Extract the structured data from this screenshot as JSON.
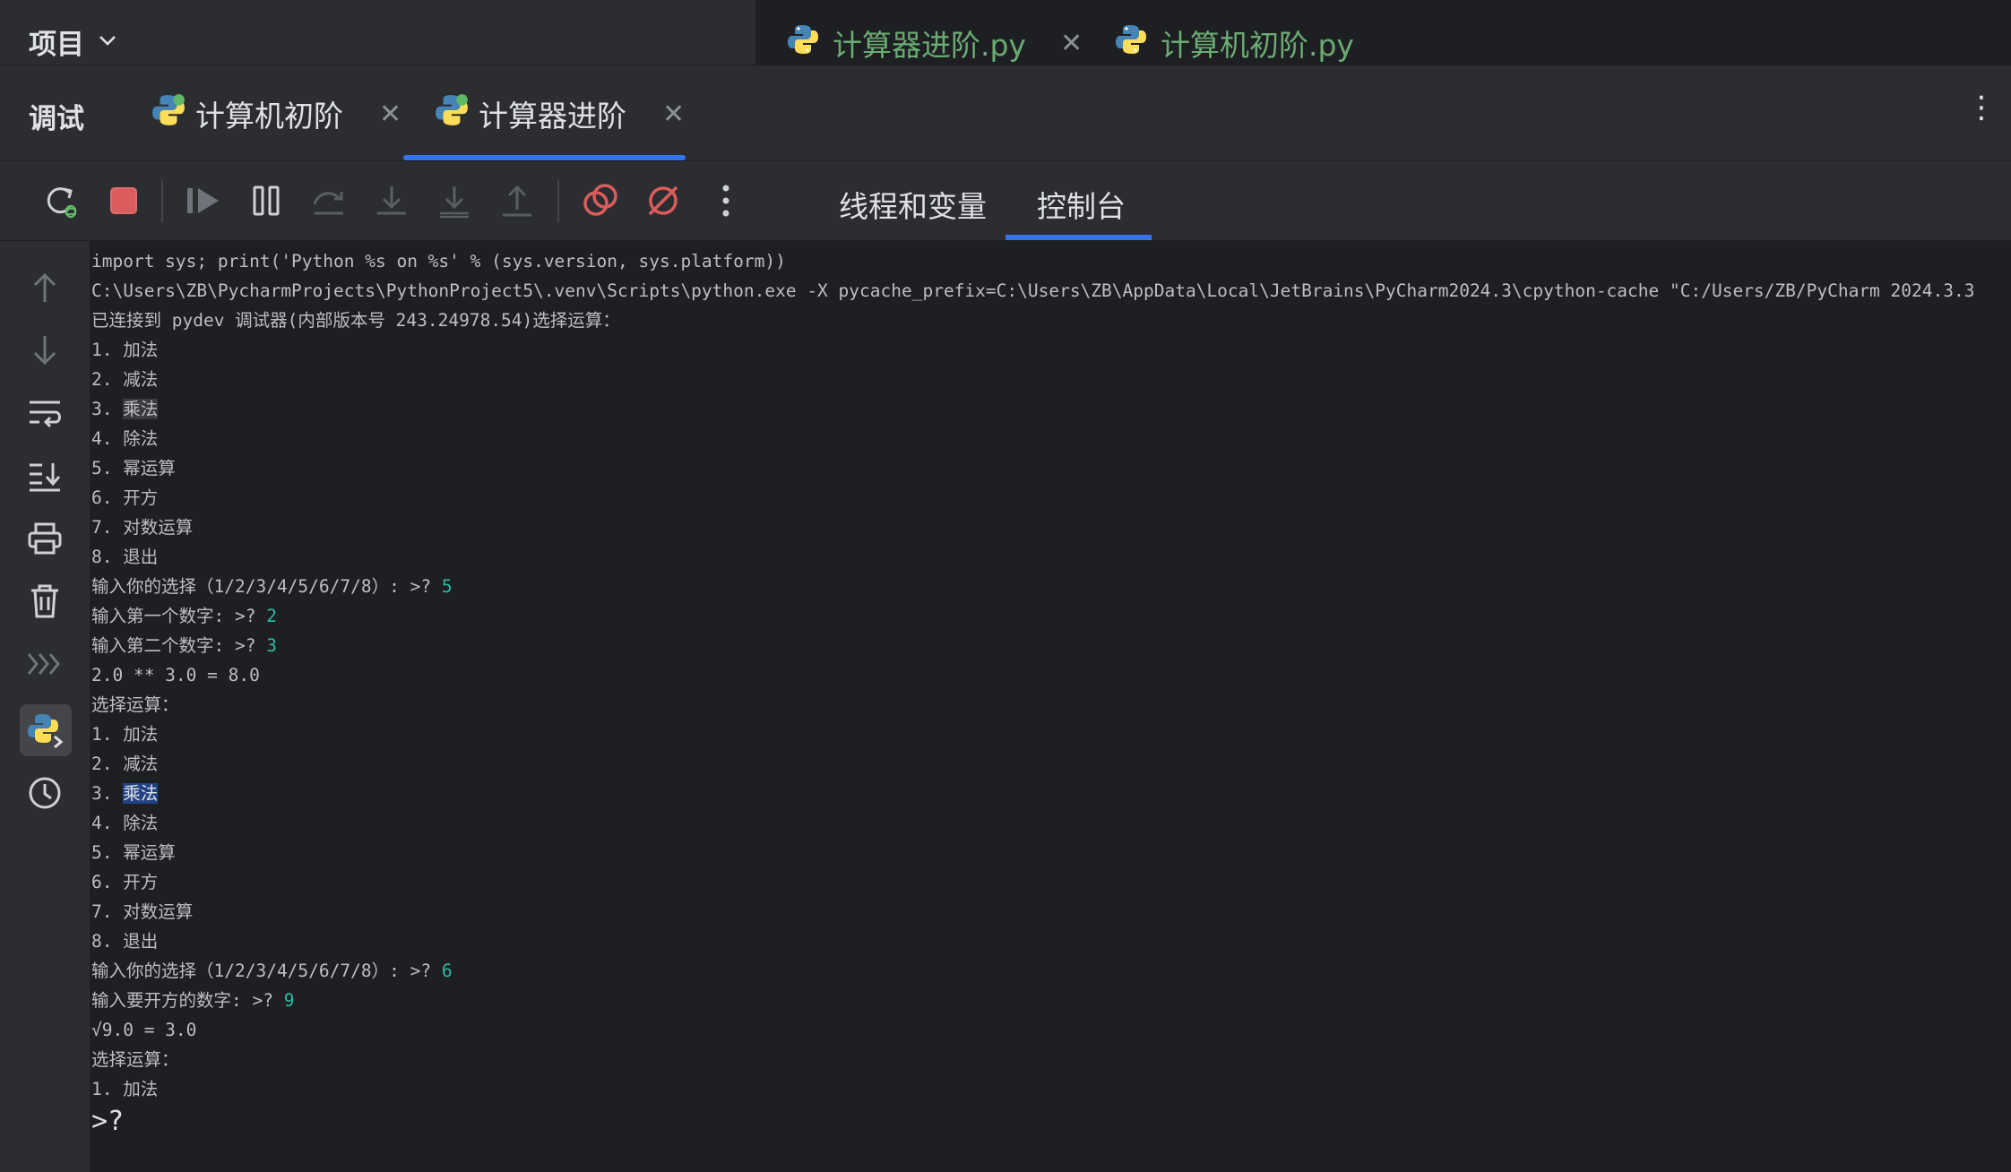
{
  "project": {
    "label": "项目"
  },
  "editor_tabs": [
    {
      "label": "计算器进阶.py"
    },
    {
      "label": "计算机初阶.py"
    }
  ],
  "debug": {
    "title": "调试",
    "tabs": [
      {
        "label": "计算机初阶"
      },
      {
        "label": "计算器进阶"
      }
    ],
    "view_tabs": [
      {
        "label": "线程和变量"
      },
      {
        "label": "控制台"
      }
    ]
  },
  "colors": {
    "accent": "#3574f0",
    "user_input": "#2fbaa3",
    "run_green": "#5fb865",
    "stop_red": "#db5c5c"
  },
  "console": {
    "lines": [
      {
        "text": "import sys; print('Python %s on %s' % (sys.version, sys.platform))"
      },
      {
        "text": "C:\\Users\\ZB\\PycharmProjects\\PythonProject5\\.venv\\Scripts\\python.exe -X pycache_prefix=C:\\Users\\ZB\\AppData\\Local\\JetBrains\\PyCharm2024.3\\cpython-cache \"C:/Users/ZB/PyCharm 2024.3.3"
      },
      {
        "text": "已连接到 pydev 调试器(内部版本号 243.24978.54)选择运算："
      },
      {
        "text": "1. 加法"
      },
      {
        "text": "2. 减法"
      },
      {
        "text": "3. ",
        "mark": "乘法",
        "mark_style": "grey"
      },
      {
        "text": "4. 除法"
      },
      {
        "text": "5. 幂运算"
      },
      {
        "text": "6. 开方"
      },
      {
        "text": "7. 对数运算"
      },
      {
        "text": "8. 退出"
      },
      {
        "text": "输入你的选择（1/2/3/4/5/6/7/8）: >? ",
        "input": "5"
      },
      {
        "text": "输入第一个数字: >? ",
        "input": "2"
      },
      {
        "text": "输入第二个数字: >? ",
        "input": "3"
      },
      {
        "text": "2.0 ** 3.0 = 8.0"
      },
      {
        "text": "选择运算："
      },
      {
        "text": "1. 加法"
      },
      {
        "text": "2. 减法"
      },
      {
        "text": "3. ",
        "mark": "乘法",
        "mark_style": "blue"
      },
      {
        "text": "4. 除法"
      },
      {
        "text": "5. 幂运算"
      },
      {
        "text": "6. 开方"
      },
      {
        "text": "7. 对数运算"
      },
      {
        "text": "8. 退出"
      },
      {
        "text": "输入你的选择（1/2/3/4/5/6/7/8）: >? ",
        "input": "6"
      },
      {
        "text": "输入要开方的数字: >? ",
        "input": "9"
      },
      {
        "text": "√9.0 = 3.0"
      },
      {
        "text": "选择运算："
      },
      {
        "text": "1. 加法"
      }
    ],
    "prompt": ">?"
  }
}
